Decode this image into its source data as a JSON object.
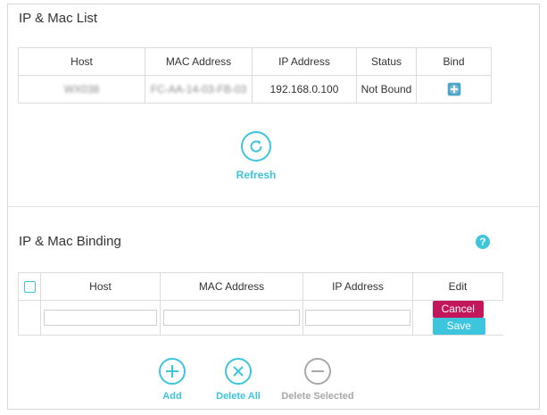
{
  "ip_mac_list": {
    "title": "IP & Mac List",
    "columns": [
      "Host",
      "MAC Address",
      "IP Address",
      "Status",
      "Bind"
    ],
    "rows": [
      {
        "host": "WX038",
        "mac": "FC-AA-14-03-FB-03",
        "ip": "192.168.0.100",
        "status": "Not Bound"
      }
    ],
    "refresh_label": "Refresh"
  },
  "ip_mac_binding": {
    "title": "IP & Mac Binding",
    "help_icon": "?",
    "columns": [
      "Host",
      "MAC Address",
      "IP Address",
      "Edit"
    ],
    "new_row": {
      "host": "",
      "mac": "",
      "ip": ""
    },
    "cancel_label": "Cancel",
    "save_label": "Save",
    "actions": {
      "add_label": "Add",
      "delete_all_label": "Delete All",
      "delete_selected_label": "Delete Selected"
    }
  },
  "colors": {
    "accent": "#3cc5dd",
    "cancel": "#c2185b",
    "disabled": "#a8a8a8"
  }
}
